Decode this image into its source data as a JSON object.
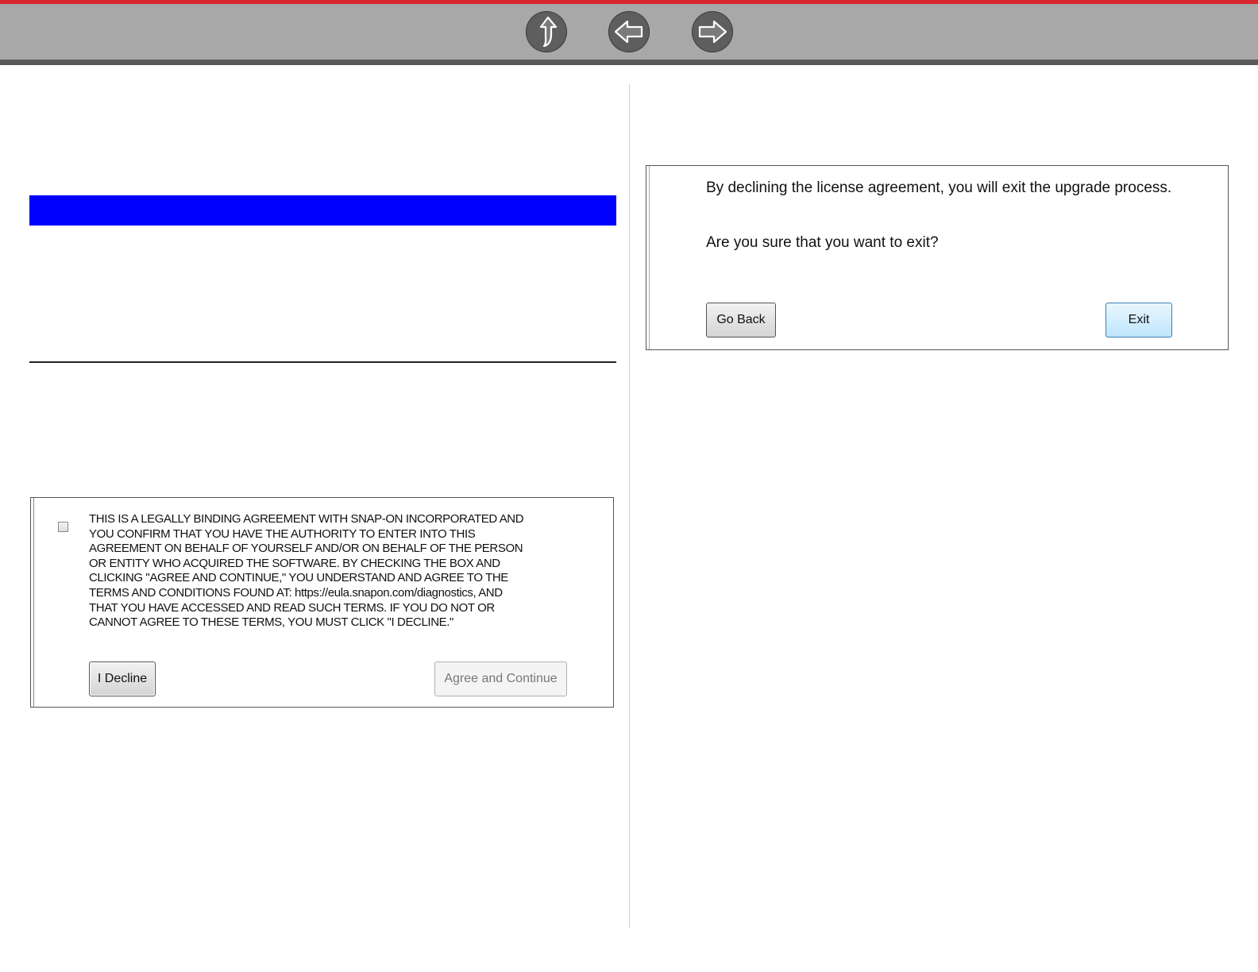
{
  "navigation": {
    "up_icon": "up-arrow-icon",
    "back_icon": "left-arrow-icon",
    "forward_icon": "right-arrow-icon",
    "accent_color": "#d8262f",
    "highlight_color": "#0000ff"
  },
  "license_dialog": {
    "text_lines": [
      "THIS IS A LEGALLY BINDING AGREEMENT WITH SNAP-ON INCORPORATED AND",
      "YOU CONFIRM THAT YOU HAVE THE AUTHORITY TO ENTER INTO THIS",
      "AGREEMENT ON BEHALF OF YOURSELF AND/OR ON BEHALF OF THE PERSON",
      "OR ENTITY WHO ACQUIRED THE SOFTWARE. BY CHECKING THE BOX AND",
      "CLICKING \"AGREE AND CONTINUE,\" YOU UNDERSTAND AND AGREE TO THE",
      "TERMS AND CONDITIONS FOUND AT: https://eula.snapon.com/diagnostics, AND",
      "THAT YOU HAVE ACCESSED AND READ SUCH TERMS. IF YOU DO NOT OR",
      "CANNOT AGREE TO THESE TERMS, YOU MUST CLICK \"I DECLINE.\""
    ],
    "decline_label": "I Decline",
    "agree_label": "Agree and Continue"
  },
  "exit_dialog": {
    "message": "By declining the license agreement, you will exit the upgrade process.",
    "question": "Are you sure that you want to exit?",
    "go_back_label": "Go Back",
    "exit_label": "Exit"
  }
}
